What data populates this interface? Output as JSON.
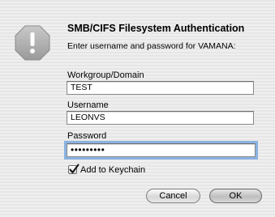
{
  "dialog": {
    "title": "SMB/CIFS Filesystem Authentication",
    "message": "Enter username and password for VAMANA:",
    "icon": "alert-icon"
  },
  "fields": {
    "workgroup": {
      "label": "Workgroup/Domain",
      "value": "TEST"
    },
    "username": {
      "label": "Username",
      "value": "LEONVS"
    },
    "password": {
      "label": "Password",
      "value": "•••••••••"
    }
  },
  "keychain": {
    "label": "Add to Keychain",
    "checked": true
  },
  "buttons": {
    "cancel": "Cancel",
    "ok": "OK"
  }
}
